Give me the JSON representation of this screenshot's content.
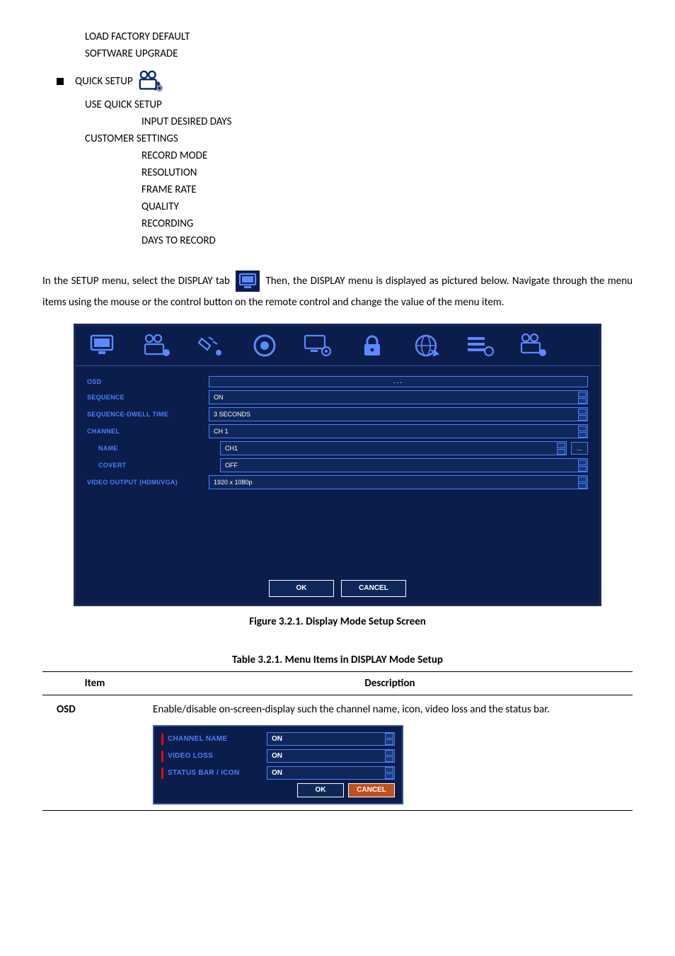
{
  "tree": {
    "top_items": [
      "LOAD FACTORY DEFAULT",
      "SOFTWARE UPGRADE"
    ],
    "quick_setup_label": "QUICK SETUP",
    "quick_setup_children": [
      "USE QUICK SETUP"
    ],
    "quick_sub_indented": [
      "INPUT DESIRED DAYS"
    ],
    "customer_settings_label": "CUSTOMER SETTINGS",
    "customer_children": [
      "RECORD MODE",
      "RESOLUTION",
      "FRAME RATE",
      "QUALITY",
      "RECORDING",
      "DAYS TO RECORD"
    ]
  },
  "paragraph": {
    "p1_a": "In the SETUP menu, select the DISPLAY tab",
    "p1_b": "Then, the DISPLAY menu is displayed as pictured below. Navigate through the menu items using the mouse or the control button on the remote control and change the value of the menu item."
  },
  "display_form": {
    "rows": [
      {
        "label": "OSD",
        "type": "osd",
        "value": "..."
      },
      {
        "label": "SEQUENCE",
        "type": "spin",
        "value": "ON"
      },
      {
        "label": "SEQUENCE-DWELL TIME",
        "type": "spin",
        "value": "3 SECONDS"
      },
      {
        "label": "CHANNEL",
        "type": "spin",
        "value": "CH 1"
      },
      {
        "label": "NAME",
        "type": "ellipsis",
        "value": "CH1",
        "sub": true
      },
      {
        "label": "COVERT",
        "type": "spin",
        "value": "OFF",
        "sub": true
      },
      {
        "label": "VIDEO OUTPUT (HDMI/VGA)",
        "type": "spin",
        "value": "1920 x 1080p"
      }
    ],
    "ok": "OK",
    "cancel": "CANCEL"
  },
  "figure_caption": "Figure 3.2.1. Display Mode Setup Screen",
  "table_caption": "Table 3.2.1. Menu Items in DISPLAY Mode Setup",
  "table_headers": {
    "item": "Item",
    "desc": "Description"
  },
  "table_row1": {
    "item": "OSD",
    "desc": "Enable/disable on-screen-display such the channel name, icon, video loss and the status bar."
  },
  "osd_popup": {
    "rows": [
      {
        "label": "CHANNEL NAME",
        "value": "ON"
      },
      {
        "label": "VIDEO LOSS",
        "value": "ON"
      },
      {
        "label": "STATUS BAR / ICON",
        "value": "ON"
      }
    ],
    "ok": "OK",
    "cancel": "CANCEL"
  }
}
